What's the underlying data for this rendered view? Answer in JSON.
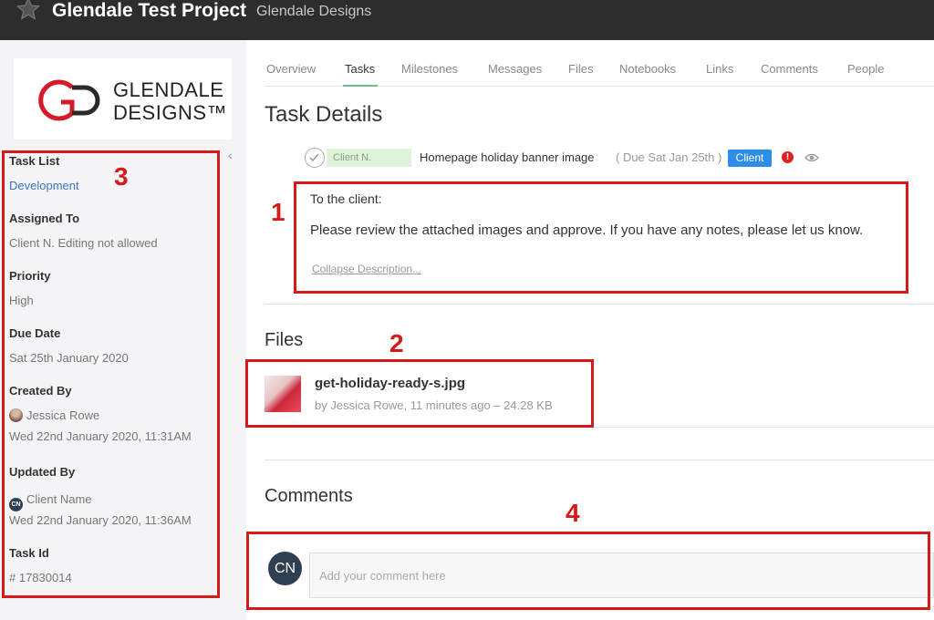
{
  "header": {
    "project_title": "Glendale Test Project",
    "company": "Glendale Designs",
    "star_icon": "star-icon"
  },
  "sidebar": {
    "logo": {
      "line1": "GLENDALE",
      "line2": "DESIGNS™"
    },
    "fields": {
      "task_list_label": "Task List",
      "task_list_value": "Development",
      "assigned_to_label": "Assigned To",
      "assigned_to_value": "Client N. Editing not allowed",
      "priority_label": "Priority",
      "priority_value": "High",
      "due_date_label": "Due Date",
      "due_date_value": "Sat 25th January 2020",
      "created_by_label": "Created By",
      "created_by_name": "Jessica Rowe",
      "created_by_date": "Wed 22nd January 2020, 11:31AM",
      "updated_by_label": "Updated By",
      "updated_by_initials": "CN",
      "updated_by_name": "Client Name",
      "updated_by_date": "Wed 22nd January 2020, 11:36AM",
      "task_id_label": "Task Id",
      "task_id_value": "# 17830014"
    }
  },
  "tabs": [
    {
      "label": "Overview"
    },
    {
      "label": "Tasks",
      "active": true
    },
    {
      "label": "Milestones"
    },
    {
      "label": "Messages"
    },
    {
      "label": "Files"
    },
    {
      "label": "Notebooks"
    },
    {
      "label": "Links"
    },
    {
      "label": "Comments"
    },
    {
      "label": "People"
    }
  ],
  "task": {
    "section_title": "Task Details",
    "assignee": "Client N.",
    "name": "Homepage holiday banner image",
    "due": "( Due Sat Jan 25th )",
    "badge": "Client",
    "priority_mark": "!",
    "description_line1": "To the client:",
    "description_line2": "Please review the attached images and approve. If you have any notes, please let us know.",
    "collapse_label": "Collapse Description..."
  },
  "files": {
    "section_title": "Files",
    "items": [
      {
        "name": "get-holiday-ready-s.jpg",
        "meta": "by Jessica Rowe, 11 minutes ago   –   24.28 KB"
      }
    ]
  },
  "comments": {
    "section_title": "Comments",
    "avatar_initials": "CN",
    "placeholder": "Add your comment here"
  },
  "annotations": {
    "n1": "1",
    "n2": "2",
    "n3": "3",
    "n4": "4",
    "color": "#d61a1a"
  },
  "colors": {
    "topbar": "#2d2d2d",
    "sidebar_bg": "#f4f4f6",
    "link": "#3a76c4",
    "badge": "#2d8ee8",
    "assignee_chip": "#dff3d8",
    "tab_underline": "#6fbf8a",
    "avatar": "#2f3e50"
  }
}
